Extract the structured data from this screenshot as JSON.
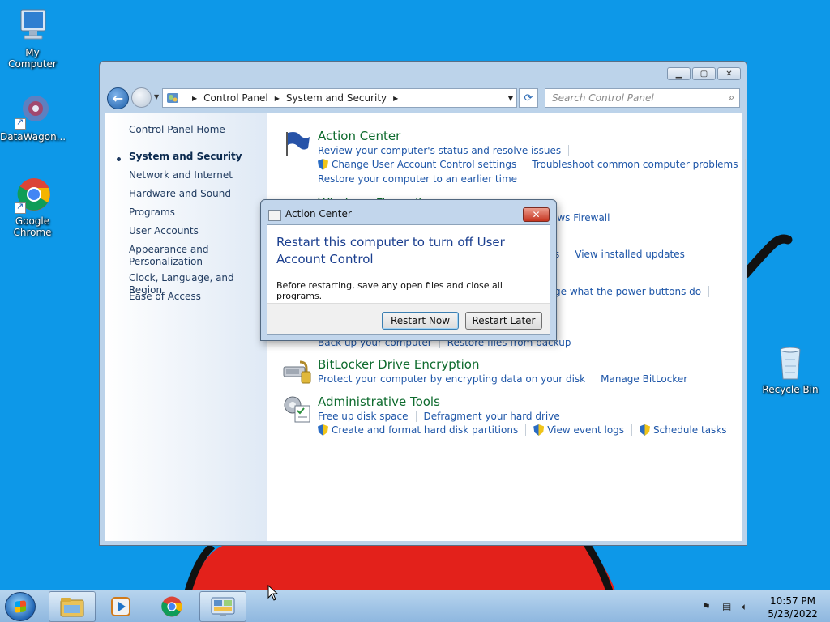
{
  "desktop": {
    "icons": [
      {
        "label": "My Computer"
      },
      {
        "label": "DataWagon..."
      },
      {
        "label": "Google Chrome"
      },
      {
        "label": "Recycle Bin"
      }
    ]
  },
  "window": {
    "address": {
      "crumbs": [
        "Control Panel",
        "System and Security"
      ]
    },
    "search_placeholder": "Search Control Panel",
    "left_pane": {
      "home": "Control Panel Home",
      "items": [
        "System and Security",
        "Network and Internet",
        "Hardware and Sound",
        "Programs",
        "User Accounts",
        "Appearance and Personalization",
        "Clock, Language, and Region",
        "Ease of Access"
      ],
      "current_index": 0
    },
    "categories": {
      "action_center": {
        "title": "Action Center",
        "link1": "Review your computer's status and resolve issues",
        "link2": "Change User Account Control settings",
        "link3": "Troubleshoot common computer problems",
        "link4": "Restore your computer to an earlier time"
      },
      "firewall_partial": {
        "title": "Windows Firewall",
        "link_partial": "ows Firewall"
      },
      "system_partial": {
        "link_partial": "s",
        "link2": "View installed updates"
      },
      "power_partial": {
        "link_partial": "ge what the power buttons do"
      },
      "backup_partial": {
        "link1": "Back up your computer",
        "link2": "Restore files from backup"
      },
      "bitlocker": {
        "title": "BitLocker Drive Encryption",
        "link1": "Protect your computer by encrypting data on your disk",
        "link2": "Manage BitLocker"
      },
      "admin_tools": {
        "title": "Administrative Tools",
        "link1": "Free up disk space",
        "link2": "Defragment your hard drive",
        "link3": "Create and format hard disk partitions",
        "link4": "View event logs",
        "link5": "Schedule tasks"
      }
    }
  },
  "dialog": {
    "title": "Action Center",
    "heading": "Restart this computer to turn off User Account Control",
    "body": "Before restarting, save any open files and close all programs.",
    "restart_now": "Restart Now",
    "restart_later": "Restart Later",
    "close": "✕"
  },
  "taskbar": {
    "time": "10:57 PM",
    "date": "5/23/2022"
  }
}
